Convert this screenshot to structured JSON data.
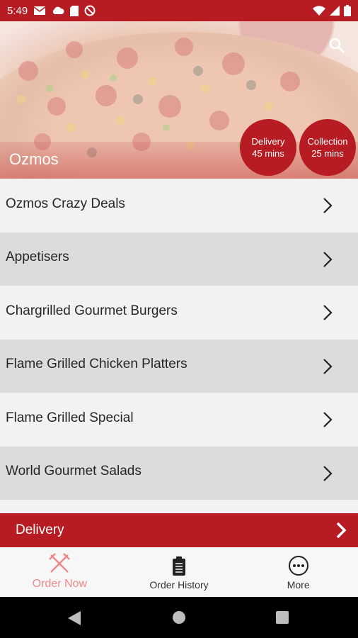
{
  "status_bar": {
    "time": "5:49",
    "left_icons": [
      "mail-icon",
      "cloud-icon",
      "sd-card-icon",
      "no-sim-icon"
    ],
    "right_icons": [
      "wifi-icon",
      "signal-icon",
      "battery-icon"
    ]
  },
  "hero": {
    "restaurant_name": "Ozmos",
    "delivery_badge": {
      "line1": "Delivery",
      "line2": "45 mins"
    },
    "collection_badge": {
      "line1": "Collection",
      "line2": "25 mins"
    }
  },
  "menu": {
    "items": [
      {
        "label": "Ozmos Crazy Deals"
      },
      {
        "label": "Appetisers"
      },
      {
        "label": "Chargrilled Gourmet Burgers"
      },
      {
        "label": "Flame Grilled Chicken Platters"
      },
      {
        "label": "Flame Grilled Special"
      },
      {
        "label": "World Gourmet Salads"
      }
    ]
  },
  "delivery_bar": {
    "label": "Delivery"
  },
  "bottom_nav": {
    "items": [
      {
        "label": "Order Now",
        "icon": "fork-knife-icon",
        "active": true
      },
      {
        "label": "Order History",
        "icon": "clipboard-icon",
        "active": false
      },
      {
        "label": "More",
        "icon": "more-icon",
        "active": false
      }
    ]
  },
  "colors": {
    "brand_red": "#b71c22",
    "active_nav": "#ef8a8a"
  }
}
